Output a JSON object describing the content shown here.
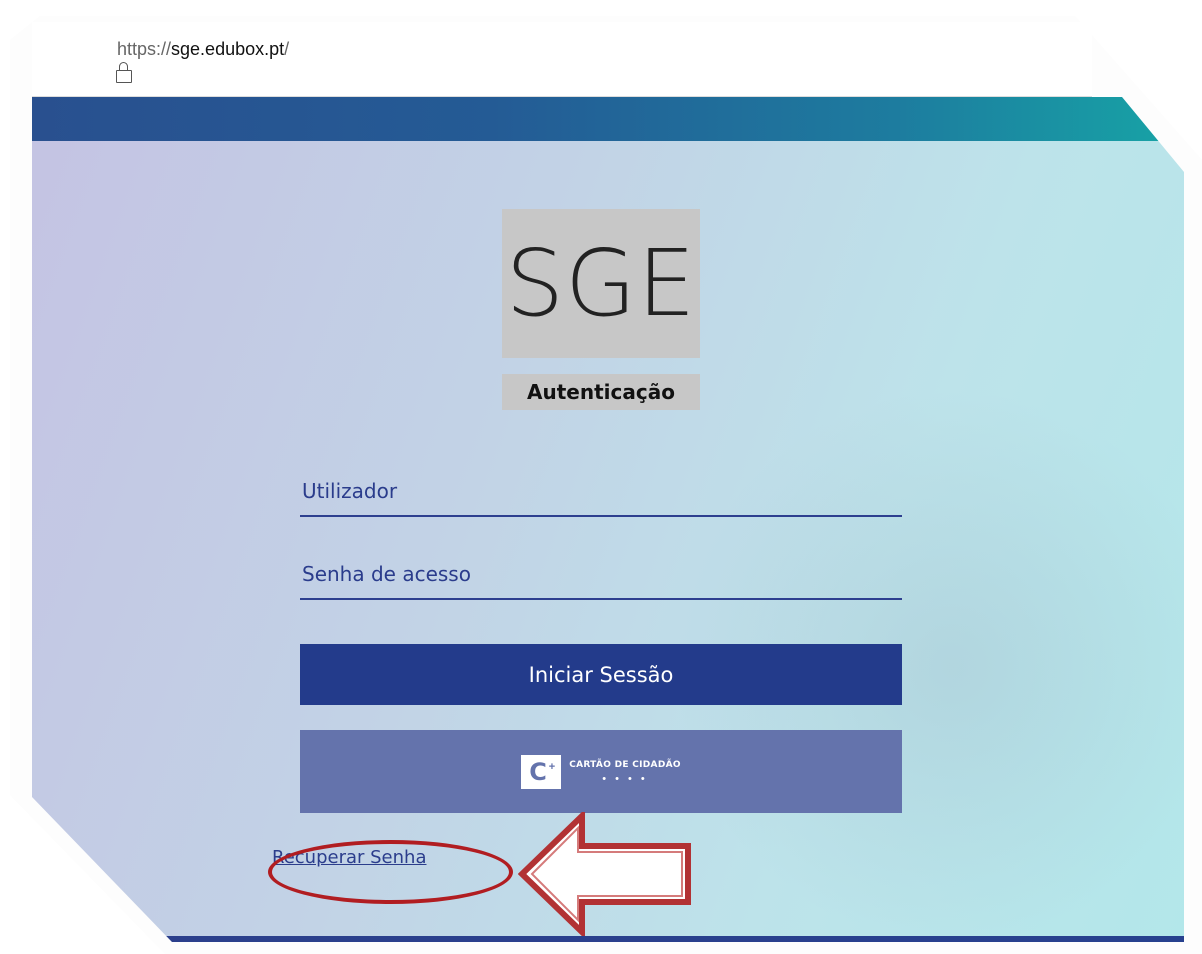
{
  "browser": {
    "url_prefix": "https://",
    "url_host": "sge.edubox.pt",
    "url_suffix": "/",
    "lock_icon": "padlock"
  },
  "login": {
    "logo_text": "SGE",
    "subtitle": "Autenticação",
    "username_placeholder": "Utilizador",
    "password_placeholder": "Senha de acesso",
    "login_button": "Iniciar Sessão",
    "cc_button_label": "CARTÃO DE CIDADÃO",
    "cc_button_dots": "• • • •",
    "recover_link": "Recuperar Senha"
  },
  "colors": {
    "primary": "#233b8b",
    "cc_button": "#6473ac",
    "annotation": "#b11d21"
  }
}
